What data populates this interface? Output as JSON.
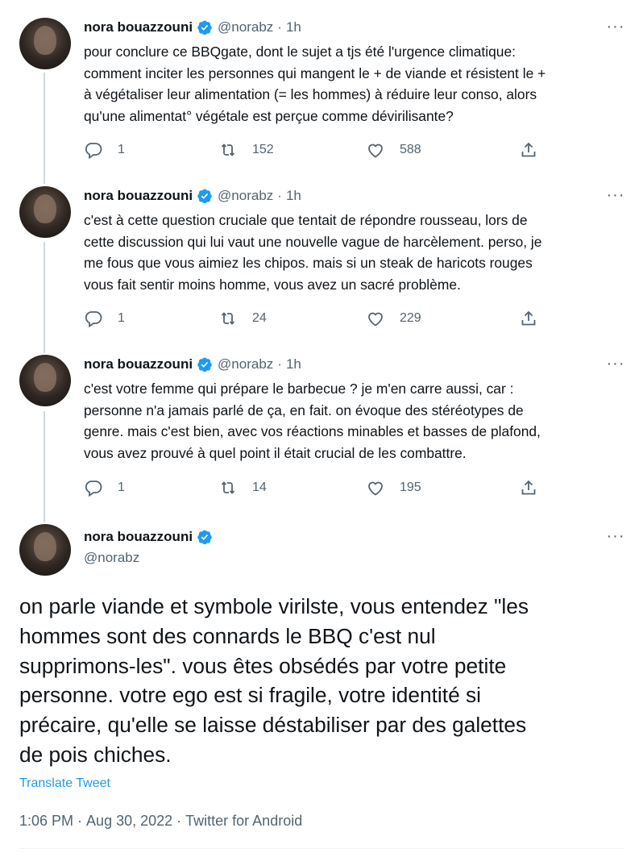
{
  "colors": {
    "accent": "#1d9bf0",
    "secondary_text": "#536471",
    "thread_line": "#cfd9de"
  },
  "icons": {
    "reply": "reply-icon",
    "retweet": "retweet-icon",
    "like": "heart-icon",
    "share": "share-icon",
    "more": "more-icon",
    "verified": "verified-badge-icon"
  },
  "thread": [
    {
      "name": "nora bouazzouni",
      "handle": "@norabz",
      "dot": "·",
      "time": "1h",
      "more": "···",
      "text": "pour conclure ce BBQgate, dont le sujet a tjs été l'urgence climatique:\ncomment inciter les personnes qui mangent le + de viande et résistent le +\nà végétaliser leur alimentation (= les hommes) à réduire leur conso, alors\nqu'une alimentat° végétale est perçue comme dévirilisante?",
      "replies": "1",
      "retweets": "152",
      "likes": "588"
    },
    {
      "name": "nora bouazzouni",
      "handle": "@norabz",
      "dot": "·",
      "time": "1h",
      "more": "···",
      "text": "c'est à cette question cruciale que tentait de répondre rousseau, lors de\ncette discussion qui lui vaut une nouvelle vague de harcèlement. perso, je\nme fous que vous aimiez les chipos. mais si un steak de haricots rouges\nvous fait sentir moins homme, vous avez un sacré problème.",
      "replies": "1",
      "retweets": "24",
      "likes": "229"
    },
    {
      "name": "nora bouazzouni",
      "handle": "@norabz",
      "dot": "·",
      "time": "1h",
      "more": "···",
      "text": "c'est votre femme qui prépare le barbecue ? je m'en carre aussi, car :\npersonne n'a jamais parlé de ça, en fait. on évoque des stéréotypes de\ngenre. mais c'est bien, avec vos réactions minables et basses de plafond,\nvous avez prouvé à quel point il était crucial de les combattre.",
      "replies": "1",
      "retweets": "14",
      "likes": "195"
    }
  ],
  "main_tweet": {
    "name": "nora bouazzouni",
    "handle": "@norabz",
    "more": "···",
    "text": "on parle viande et symbole virilste, vous entendez \"les\nhommes sont des connards le BBQ c'est nul\nsupprimons-les\". vous êtes obsédés par votre petite\npersonne. votre ego est si fragile, votre identité si\nprécaire, qu'elle se laisse déstabiliser par des galettes\nde pois chiches.",
    "translate_label": "Translate Tweet",
    "time": "1:06 PM",
    "sep": "·",
    "date": "Aug 30, 2022",
    "source": "Twitter for Android"
  }
}
